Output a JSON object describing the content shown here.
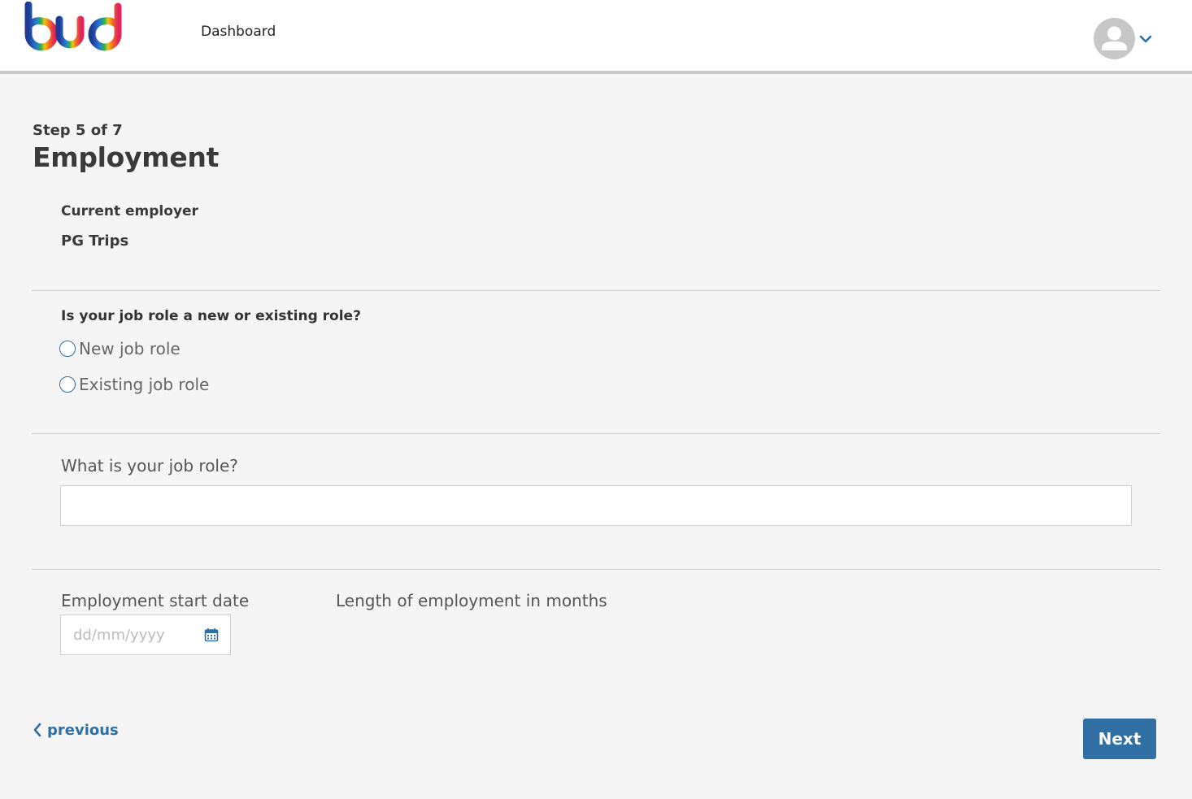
{
  "header": {
    "logo_text": "bud",
    "nav_dashboard": "Dashboard",
    "avatar_icon": "user-avatar-icon",
    "menu_icon": "chevron-down-icon"
  },
  "page": {
    "step": "Step 5 of 7",
    "title": "Employment"
  },
  "employer": {
    "label": "Current employer",
    "value": "PG Trips"
  },
  "job_role_type": {
    "question": "Is your job role a new or existing role?",
    "options": [
      {
        "label": "New job role",
        "selected": false
      },
      {
        "label": "Existing job role",
        "selected": false
      }
    ]
  },
  "job_role": {
    "label": "What is your job role?",
    "value": ""
  },
  "start_date": {
    "label": "Employment start date",
    "placeholder": "dd/mm/yyyy",
    "value": "",
    "icon": "calendar-icon"
  },
  "length_of_employment": {
    "label": "Length of employment in months"
  },
  "footer": {
    "previous_label": "previous",
    "next_label": "Next"
  },
  "colors": {
    "accent": "#2f6fa3",
    "background": "#f5f5f5",
    "header_border": "#c9c9c9"
  }
}
